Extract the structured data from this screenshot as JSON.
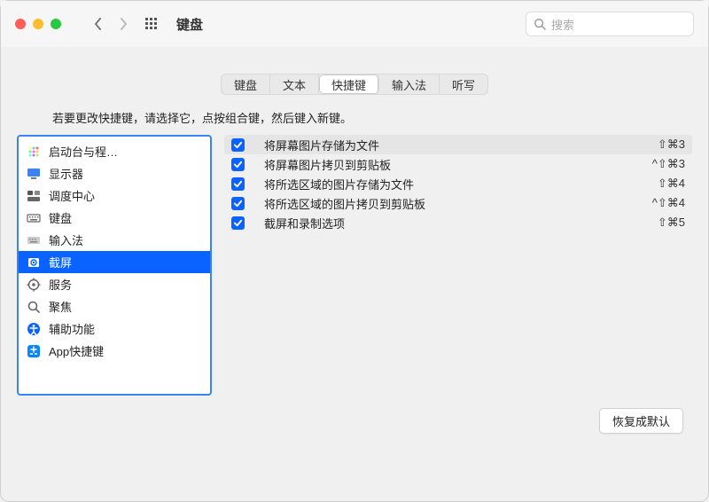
{
  "window": {
    "title": "键盘"
  },
  "search": {
    "placeholder": "搜索"
  },
  "tabs": [
    {
      "label": "键盘",
      "selected": false
    },
    {
      "label": "文本",
      "selected": false
    },
    {
      "label": "快捷键",
      "selected": true
    },
    {
      "label": "输入法",
      "selected": false
    },
    {
      "label": "听写",
      "selected": false
    }
  ],
  "instruction": "若要更改快捷键，请选择它，点按组合键，然后键入新键。",
  "sidebar": {
    "items": [
      {
        "label": "启动台与程…",
        "icon": "launchpad"
      },
      {
        "label": "显示器",
        "icon": "display"
      },
      {
        "label": "调度中心",
        "icon": "mission-control"
      },
      {
        "label": "键盘",
        "icon": "keyboard"
      },
      {
        "label": "输入法",
        "icon": "input-sources"
      },
      {
        "label": "截屏",
        "icon": "screenshot",
        "selected": true
      },
      {
        "label": "服务",
        "icon": "gear"
      },
      {
        "label": "聚焦",
        "icon": "spotlight"
      },
      {
        "label": "辅助功能",
        "icon": "accessibility"
      },
      {
        "label": "App快捷键",
        "icon": "app-store"
      }
    ]
  },
  "shortcuts": [
    {
      "enabled": true,
      "label": "将屏幕图片存储为文件",
      "keys": "⇧⌘3",
      "selected": true
    },
    {
      "enabled": true,
      "label": "将屏幕图片拷贝到剪贴板",
      "keys": "^⇧⌘3"
    },
    {
      "enabled": true,
      "label": "将所选区域的图片存储为文件",
      "keys": "⇧⌘4"
    },
    {
      "enabled": true,
      "label": "将所选区域的图片拷贝到剪贴板",
      "keys": "^⇧⌘4"
    },
    {
      "enabled": true,
      "label": "截屏和录制选项",
      "keys": "⇧⌘5"
    }
  ],
  "buttons": {
    "restore": "恢复成默认"
  }
}
